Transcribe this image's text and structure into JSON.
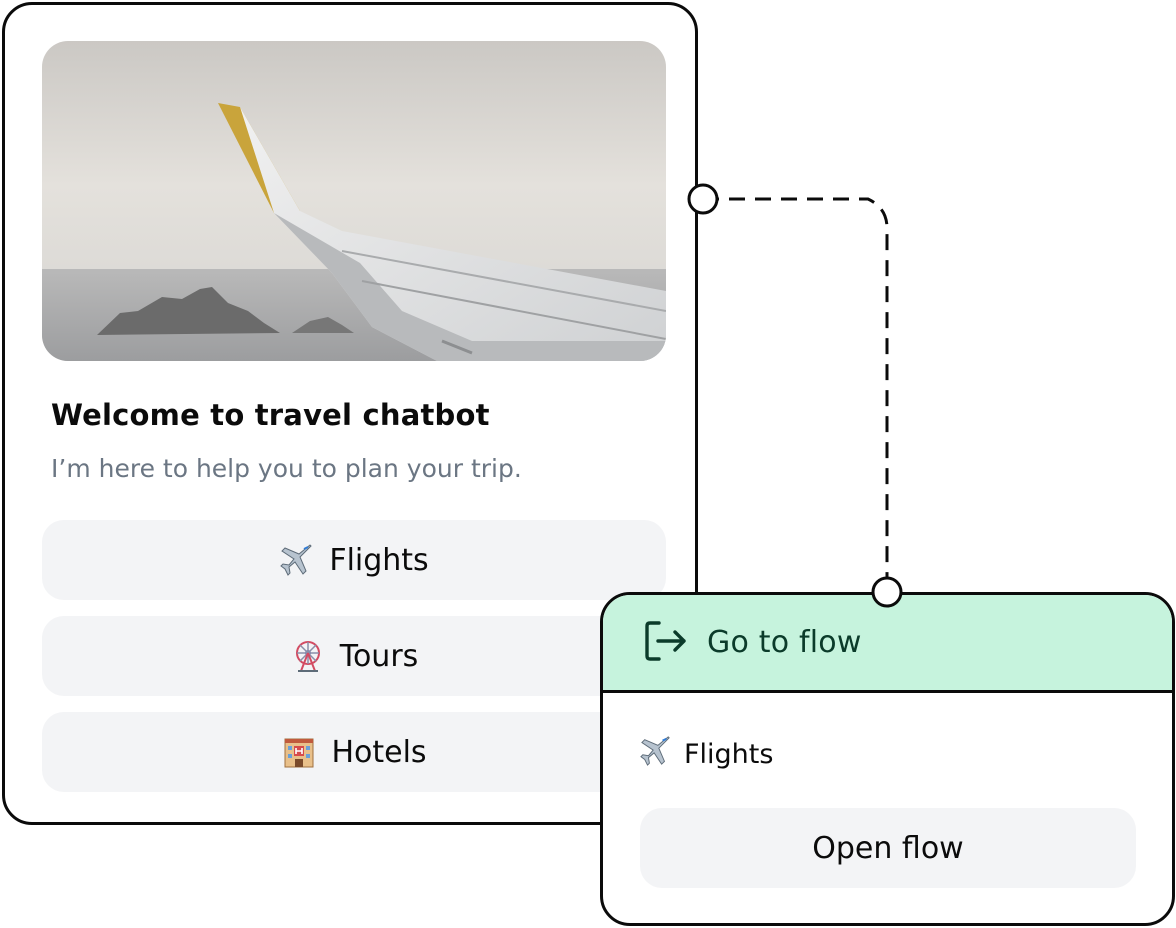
{
  "card": {
    "title": "Welcome to travel chatbot",
    "subtitle": "I’m here to help you to plan your trip.",
    "hero_image": "airplane-wing-over-sea",
    "options": [
      {
        "icon": "airplane-icon",
        "label": "Flights"
      },
      {
        "icon": "ferris-wheel-icon",
        "label": "Tours"
      },
      {
        "icon": "hotel-icon",
        "label": "Hotels"
      }
    ]
  },
  "node": {
    "icon": "exit-arrow-icon",
    "title": "Go to flow",
    "flow": {
      "icon": "airplane-icon",
      "label": "Flights"
    },
    "button_label": "Open flow"
  },
  "colors": {
    "node_header_bg": "#c6f3dd",
    "node_title": "#0b3b2a",
    "option_bg": "#f3f4f6",
    "subtitle": "#6b7683",
    "wing_tip": "#c9a43b"
  }
}
